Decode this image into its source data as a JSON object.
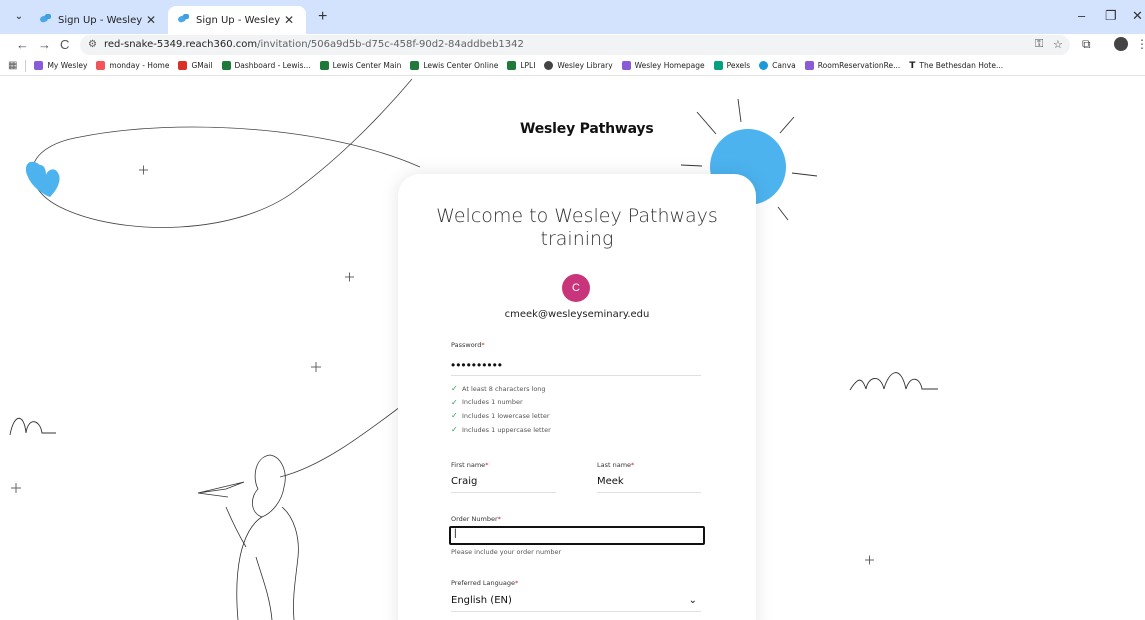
{
  "browser": {
    "tabs": [
      {
        "title": "Sign Up - Wesley Pathways",
        "active": false
      },
      {
        "title": "Sign Up - Wesley Pathways",
        "active": true
      }
    ],
    "new_tab": "+",
    "close_glyph": "✕",
    "window_controls": {
      "minimize": "–",
      "restore": "❐",
      "close": "✕"
    },
    "nav": {
      "back": "←",
      "forward": "→",
      "reload": "C"
    },
    "url_host": "red-snake-5349.reach360.com",
    "url_path": "/invitation/506a9d5b-d75c-458f-90d2-84addbeb1342",
    "bookmarks": [
      {
        "label": "My Wesley",
        "color": "#8a5bd6"
      },
      {
        "label": "monday - Home",
        "color": "#f2545b"
      },
      {
        "label": "GMail",
        "color": "#d93025"
      },
      {
        "label": "Dashboard - Lewis...",
        "color": "#1f7a3a"
      },
      {
        "label": "Lewis Center Main",
        "color": "#1f7a3a"
      },
      {
        "label": "Lewis Center Online",
        "color": "#1f7a3a"
      },
      {
        "label": "LPLI",
        "color": "#1f7a3a"
      },
      {
        "label": "Wesley Library",
        "color": "#444444"
      },
      {
        "label": "Wesley Homepage",
        "color": "#8a5bd6"
      },
      {
        "label": "Pexels",
        "color": "#05a081"
      },
      {
        "label": "Canva",
        "color": "#1a9ad9"
      },
      {
        "label": "RoomReservationRe...",
        "color": "#8a5bd6"
      },
      {
        "label": "The Bethesdan Hote...",
        "color": "#222222"
      }
    ],
    "bookmark_t_glyph": "T"
  },
  "page": {
    "brand": "Wesley Pathways",
    "welcome": "Welcome to Wesley Pathways training",
    "avatar_initial": "C",
    "avatar_color": "#c9357b",
    "email": "cmeek@wesleyseminary.edu",
    "password": {
      "label": "Password",
      "required": "*",
      "value": "••••••••••"
    },
    "rules": [
      "At least 8 characters long",
      "Includes 1 number",
      "Includes 1 lowercase letter",
      "Includes 1 uppercase letter"
    ],
    "check_glyph": "✓",
    "first_name": {
      "label": "First name",
      "value": "Craig"
    },
    "last_name": {
      "label": "Last name",
      "value": "Meek"
    },
    "order_number": {
      "label": "Order Number",
      "value": "",
      "hint": "Please include your order number"
    },
    "language": {
      "label": "Preferred Language",
      "value": "English (EN)"
    },
    "required_mark": "*",
    "colors": {
      "sun": "#4cb3ef",
      "heart": "#4cb3ef",
      "accent_red": "#c0262d"
    }
  }
}
